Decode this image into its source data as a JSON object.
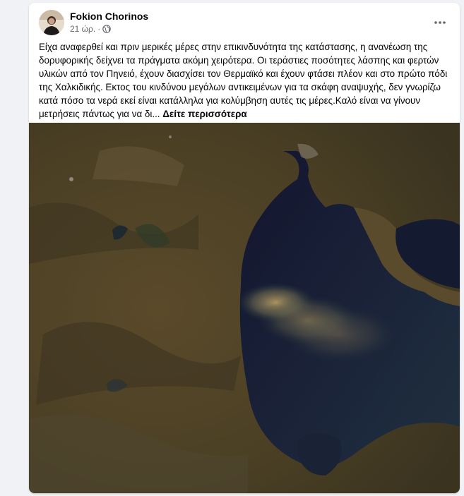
{
  "post": {
    "author": "Fokion Chorinos",
    "time": "21 ώρ.",
    "separator": "·",
    "privacy_icon": "globe-icon",
    "more_icon": "more-options-icon",
    "text": "Είχα αναφερθεί και πριν μερικές μέρες στην επικινδυνότητα της κατάστασης, η ανανέωση της δορυφορικής δείχνει τα πράγματα ακόμη χειρότερα. Οι τεράστιες ποσότητες λάσπης και φερτών υλικών από τον Πηνειό, έχουν διασχίσει τον Θερμαϊκό και έχουν φτάσει πλέον και στο πρώτο πόδι της Χαλκιδικής. Εκτος του κινδύνου μεγάλων αντικειμένων για τα σκάφη αναψυχής, δεν γνωρίζω κατά πόσο τα νερά εκεί είναι κατάλληλα για κολύμβηση αυτές τις μέρες.Καλό είναι να γίνουν μετρήσεις πάντως για να δι...",
    "see_more": "Δείτε περισσότερα",
    "image_description_icon": "satellite-image"
  },
  "colors": {
    "page_bg": "#f0f2f5",
    "card_bg": "#ffffff",
    "text": "#050505",
    "secondary_text": "#65676b"
  }
}
